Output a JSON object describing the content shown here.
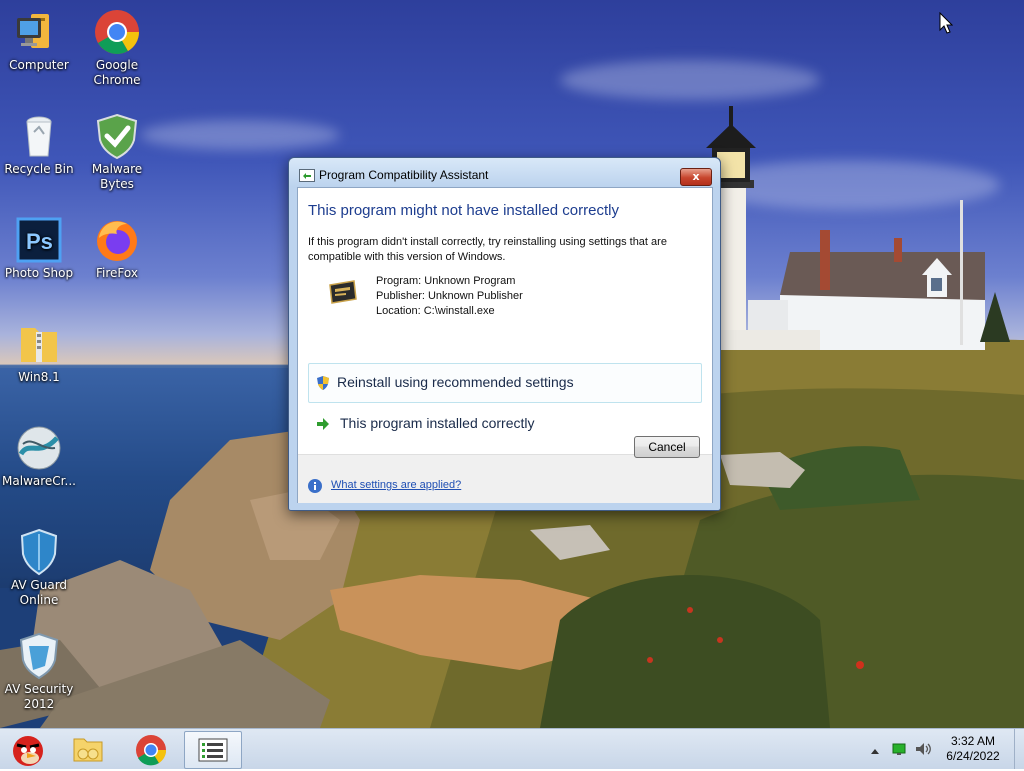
{
  "desktop": {
    "icons": [
      {
        "label_lines": [
          "Computer"
        ],
        "icon": "computer-icon"
      },
      {
        "label_lines": [
          "Google",
          "Chrome"
        ],
        "icon": "chrome-icon"
      },
      {
        "label_lines": [
          "Recycle Bin"
        ],
        "icon": "recycle-bin-icon"
      },
      {
        "label_lines": [
          "Malware",
          "Bytes"
        ],
        "icon": "shield-check-icon"
      },
      {
        "label_lines": [
          "Photo Shop"
        ],
        "icon": "photoshop-icon"
      },
      {
        "label_lines": [
          "FireFox"
        ],
        "icon": "firefox-icon"
      },
      {
        "label_lines": [
          "Win8.1"
        ],
        "icon": "zip-folder-icon"
      },
      {
        "label_lines": [
          "MalwareCr..."
        ],
        "icon": "malware-crusher-icon"
      },
      {
        "label_lines": [
          "AV Guard",
          "Online"
        ],
        "icon": "av-guard-shield-icon"
      },
      {
        "label_lines": [
          "AV Security",
          "2012"
        ],
        "icon": "av-security-icon"
      }
    ]
  },
  "dialog": {
    "title": "Program Compatibility Assistant",
    "close_label": "x",
    "heading": "This program might not have installed correctly",
    "description": "If this program didn't install correctly, try reinstalling using settings that are compatible with this version of Windows.",
    "program_line": "Program: Unknown Program",
    "publisher_line": "Publisher: Unknown Publisher",
    "location_line": "Location: C:\\winstall.exe",
    "option_reinstall": "Reinstall using recommended settings",
    "option_installed": "This program installed correctly",
    "cancel_label": "Cancel",
    "help_link": "What settings are applied?"
  },
  "taskbar": {
    "items": [
      "angry-birds-icon",
      "folder-icon",
      "chrome-icon",
      "task-list-icon"
    ],
    "tray_icons": [
      "show-hidden-icons-arrow",
      "network-icon",
      "volume-icon"
    ],
    "time": "3:32 AM",
    "date": "6/24/2022"
  },
  "colors": {
    "heading": "#1d3d8f",
    "link": "#1f4fb3",
    "close_button": "#c7452d"
  }
}
